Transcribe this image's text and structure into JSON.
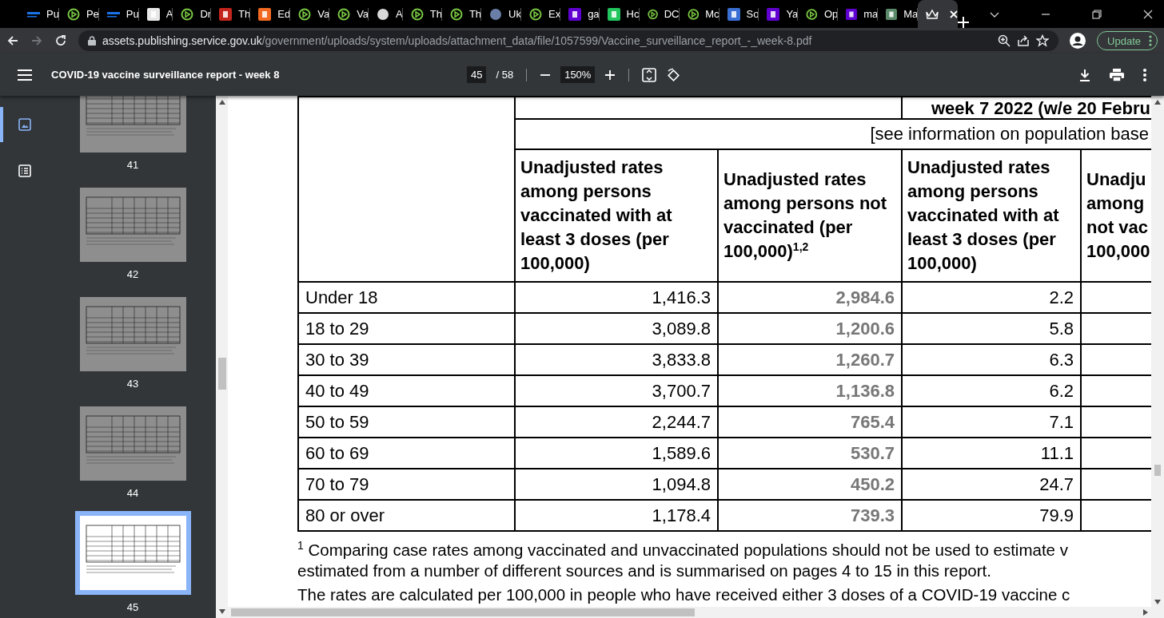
{
  "tabs": [
    {
      "title": "Pu",
      "kind": "lines",
      "color": "#1a73e8",
      "selected": false
    },
    {
      "title": "Pe",
      "kind": "play",
      "selected": false
    },
    {
      "title": "Pu",
      "kind": "lines",
      "color": "#1a73e8",
      "selected": false
    },
    {
      "title": "A",
      "kind": "square",
      "color": "#e8e8e8",
      "selected": false
    },
    {
      "title": "Dr",
      "kind": "play",
      "selected": false
    },
    {
      "title": "Th",
      "kind": "square",
      "color": "#c4261d",
      "selected": false
    },
    {
      "title": "Ed",
      "kind": "square",
      "color": "#f26a21",
      "selected": false
    },
    {
      "title": "Va",
      "kind": "play",
      "selected": false
    },
    {
      "title": "Va",
      "kind": "play",
      "selected": false
    },
    {
      "title": "A",
      "kind": "circle",
      "color": "#d8d8d8",
      "selected": false
    },
    {
      "title": "Th",
      "kind": "play",
      "selected": false
    },
    {
      "title": "Th",
      "kind": "play",
      "selected": false
    },
    {
      "title": "Uk",
      "kind": "circle",
      "color": "#6a7fa8",
      "selected": false
    },
    {
      "title": "Ex",
      "kind": "play",
      "selected": false
    },
    {
      "title": "ga",
      "kind": "square",
      "color": "#6001d2",
      "selected": false
    },
    {
      "title": "Hc",
      "kind": "square",
      "color": "#22c55e",
      "selected": false
    },
    {
      "title": "DC",
      "kind": "play",
      "selected": false
    },
    {
      "title": "Mc",
      "kind": "play",
      "selected": false
    },
    {
      "title": "So",
      "kind": "square",
      "color": "#3b6fd4",
      "selected": false
    },
    {
      "title": "Ya",
      "kind": "square",
      "color": "#6001d2",
      "selected": false
    },
    {
      "title": "Op",
      "kind": "play",
      "selected": false
    },
    {
      "title": "ma",
      "kind": "square",
      "color": "#6001d2",
      "selected": false
    },
    {
      "title": "Ma",
      "kind": "square",
      "color": "#5a8a6a",
      "selected": false
    },
    {
      "kind": "crown",
      "selected": true
    }
  ],
  "address_bar": {
    "host": "assets.publishing.service.gov.uk",
    "path": "/government/uploads/system/uploads/attachment_data/file/1057599/Vaccine_surveillance_report_-_week-8.pdf",
    "forward_disabled": true,
    "update_button": "Update"
  },
  "pdf_toolbar": {
    "title": "COVID-19 vaccine surveillance report - week 8",
    "page": "45",
    "page_count": "/ 58",
    "zoom": "150%"
  },
  "sidebar": {
    "views": [
      {
        "kind": "thumbnails",
        "selected": true
      },
      {
        "kind": "outline",
        "selected": false
      }
    ],
    "thumbnails": [
      {
        "label": "41",
        "selected": false
      },
      {
        "label": "42",
        "selected": false
      },
      {
        "label": "43",
        "selected": false
      },
      {
        "label": "44",
        "selected": false
      },
      {
        "label": "45",
        "selected": true
      }
    ]
  },
  "table": {
    "period": "week 7 2022 (w/e 20 Febru",
    "population_note": "[see information on population base",
    "columns": [
      {
        "heading": "Unadjusted rates among persons vaccinated with at least 3 doses (per 100,000)"
      },
      {
        "heading": "Unadjusted rates among persons not vaccinated (per 100,000)$^{1,2}$"
      },
      {
        "heading": "Unadjusted rates among persons vaccinated with at least 3 doses (per 100,000)"
      },
      {
        "heading": "Unadju among not vac 100,000"
      }
    ],
    "rows": [
      {
        "label": "Under 18",
        "cells": [
          {
            "text": "1,416.3",
            "highlighted": false
          },
          {
            "text": "2,984.6",
            "highlighted": true
          },
          {
            "text": "2.2",
            "highlighted": false
          }
        ]
      },
      {
        "label": "18 to 29",
        "cells": [
          {
            "text": "3,089.8",
            "highlighted": false
          },
          {
            "text": "1,200.6",
            "highlighted": true
          },
          {
            "text": "5.8",
            "highlighted": false
          }
        ]
      },
      {
        "label": "30 to 39",
        "cells": [
          {
            "text": "3,833.8",
            "highlighted": false
          },
          {
            "text": "1,260.7",
            "highlighted": true
          },
          {
            "text": "6.3",
            "highlighted": false
          }
        ]
      },
      {
        "label": "40 to 49",
        "cells": [
          {
            "text": "3,700.7",
            "highlighted": false
          },
          {
            "text": "1,136.8",
            "highlighted": true
          },
          {
            "text": "6.2",
            "highlighted": false
          }
        ]
      },
      {
        "label": "50 to 59",
        "cells": [
          {
            "text": "2,244.7",
            "highlighted": false
          },
          {
            "text": "765.4",
            "highlighted": true
          },
          {
            "text": "7.1",
            "highlighted": false
          }
        ]
      },
      {
        "label": "60 to 69",
        "cells": [
          {
            "text": "1,589.6",
            "highlighted": false
          },
          {
            "text": "530.7",
            "highlighted": true
          },
          {
            "text": "11.1",
            "highlighted": false
          }
        ]
      },
      {
        "label": "70 to 79",
        "cells": [
          {
            "text": "1,094.8",
            "highlighted": false
          },
          {
            "text": "450.2",
            "highlighted": true
          },
          {
            "text": "24.7",
            "highlighted": false
          }
        ]
      },
      {
        "label": "80 or over",
        "cells": [
          {
            "text": "1,178.4",
            "highlighted": false
          },
          {
            "text": "739.3",
            "highlighted": true
          },
          {
            "text": "79.9",
            "highlighted": false
          }
        ]
      }
    ]
  },
  "footnote_lines": [
    "$^{1}$ Comparing case rates among vaccinated and unvaccinated populations should not be used to estimate v",
    "estimated from a number of different sources and is summarised on pages 4 to 15 in this report."
  ],
  "body_text": "The rates are calculated per 100,000 in people who have received either 3 doses of a COVID-19 vaccine c"
}
